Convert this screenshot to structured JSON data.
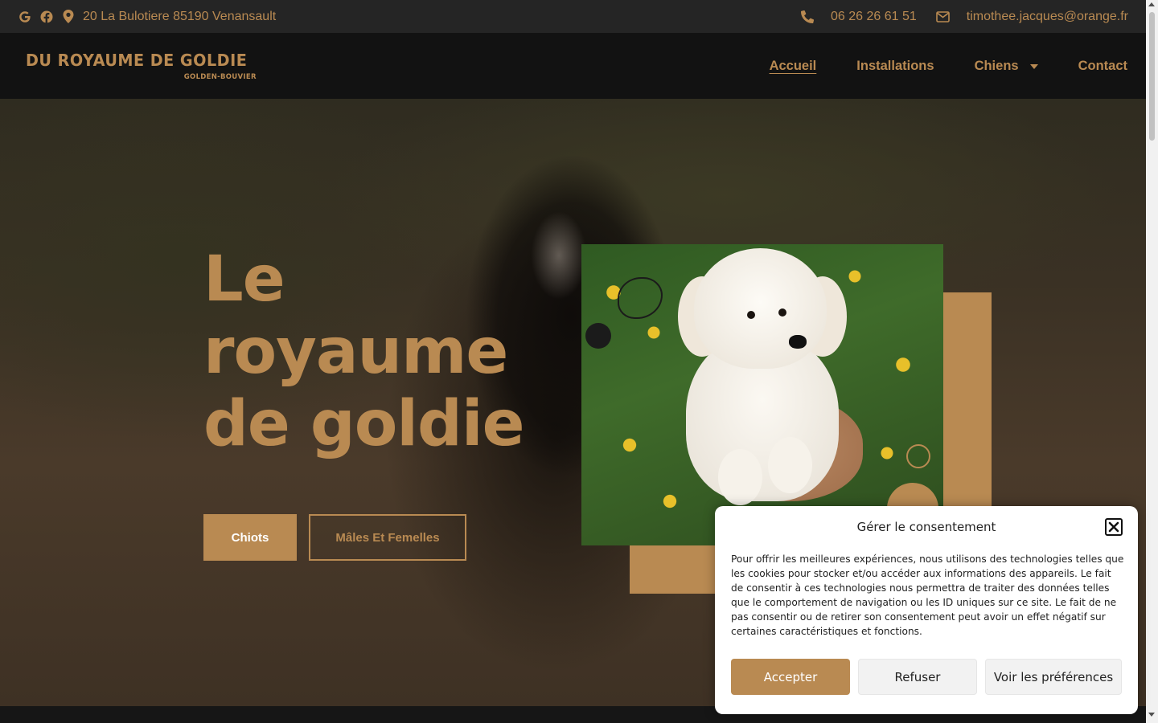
{
  "topbar": {
    "address": "20 La Bulotiere 85190 Venansault",
    "phone": "06 26 26 61 51",
    "email": "timothee.jacques@orange.fr",
    "icons": [
      "google-icon",
      "facebook-icon",
      "map-pin-icon",
      "phone-icon",
      "envelope-icon"
    ]
  },
  "header": {
    "logo_main": "DU ROYAUME DE GOLDIE",
    "logo_sub": "GOLDEN-BOUVIER",
    "nav": [
      {
        "label": "Accueil",
        "active": true
      },
      {
        "label": "Installations",
        "active": false
      },
      {
        "label": "Chiens",
        "active": false,
        "has_dropdown": true
      },
      {
        "label": "Contact",
        "active": false
      }
    ]
  },
  "hero": {
    "title_line1": "Le",
    "title_line2": "royaume",
    "title_line3": "de goldie",
    "primary_button": "Chiots",
    "secondary_button": "Mâles Et Femelles"
  },
  "consent": {
    "title": "Gérer le consentement",
    "body": "Pour offrir les meilleures expériences, nous utilisons des technologies telles que les cookies pour stocker et/ou accéder aux informations des appareils. Le fait de consentir à ces technologies nous permettra de traiter des données telles que le comportement de navigation ou les ID uniques sur ce site. Le fait de ne pas consentir ou de retirer son consentement peut avoir un effet négatif sur certaines caractéristiques et fonctions.",
    "accept": "Accepter",
    "refuse": "Refuser",
    "preferences": "Voir les préférences"
  },
  "colors": {
    "accent": "#b98a52",
    "topbar_bg": "#252525",
    "header_bg": "#121212"
  }
}
